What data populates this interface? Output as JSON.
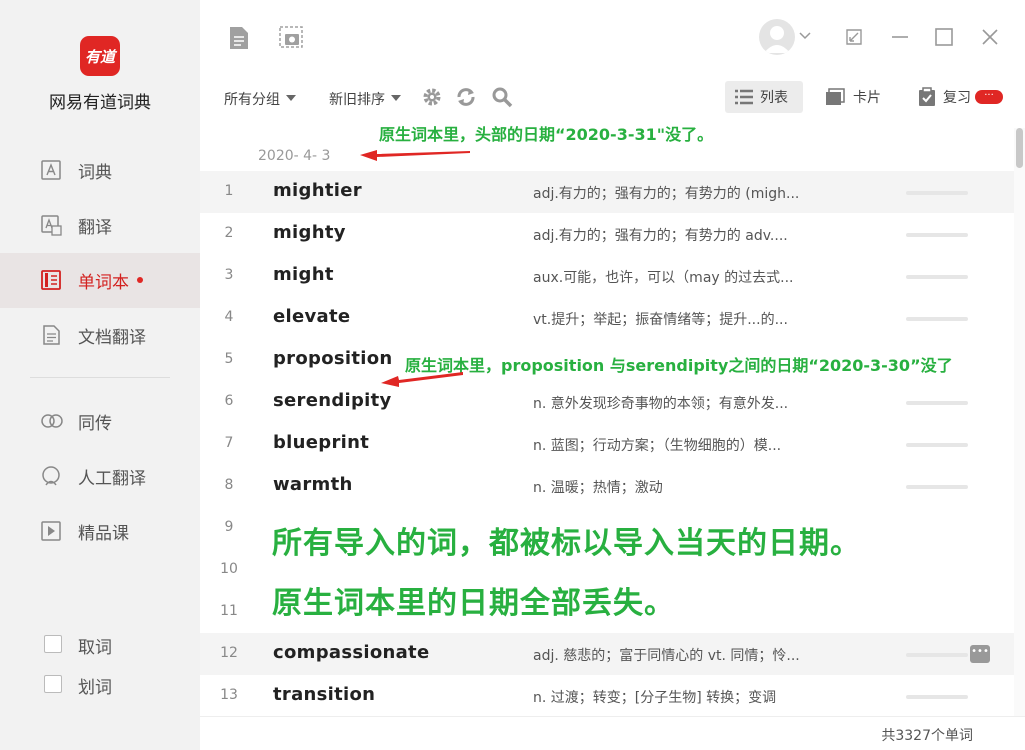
{
  "app": {
    "logo_text": "有道",
    "name": "网易有道词典"
  },
  "sidebar": {
    "items": [
      {
        "label": "词典",
        "icon": "dictionary-icon"
      },
      {
        "label": "翻译",
        "icon": "translate-icon"
      },
      {
        "label": "单词本",
        "icon": "wordbook-icon",
        "active": true
      },
      {
        "label": "文档翻译",
        "icon": "document-translate-icon"
      },
      {
        "label": "同传",
        "icon": "simultaneous-interpretation-icon"
      },
      {
        "label": "人工翻译",
        "icon": "human-translation-icon"
      },
      {
        "label": "精品课",
        "icon": "course-icon"
      }
    ],
    "checkboxes": [
      {
        "label": "取词"
      },
      {
        "label": "划词"
      }
    ]
  },
  "toolbar": {
    "group_filter": "所有分组",
    "sort_order": "新旧排序",
    "views": [
      {
        "label": "列表",
        "active": true
      },
      {
        "label": "卡片"
      },
      {
        "label": "复习",
        "badge": "···"
      }
    ]
  },
  "list": {
    "date_header": "2020- 4- 3",
    "rows": [
      {
        "num": "1",
        "word": "mightier",
        "def": "adj.有力的；强有力的；有势力的 (migh..."
      },
      {
        "num": "2",
        "word": "mighty",
        "def": "adj.有力的；强有力的；有势力的 adv...."
      },
      {
        "num": "3",
        "word": "might",
        "def": "aux.可能，也许，可以（may 的过去式..."
      },
      {
        "num": "4",
        "word": "elevate",
        "def": "vt.提升；举起；振奋情绪等；提升...的..."
      },
      {
        "num": "5",
        "word": "proposition",
        "def": ""
      },
      {
        "num": "6",
        "word": "serendipity",
        "def": "n. 意外发现珍奇事物的本领；有意外发..."
      },
      {
        "num": "7",
        "word": "blueprint",
        "def": "n. 蓝图；行动方案；（生物细胞的）模..."
      },
      {
        "num": "8",
        "word": "warmth",
        "def": "n. 温暖；热情；激动"
      },
      {
        "num": "9",
        "word": "",
        "def": ""
      },
      {
        "num": "10",
        "word": "",
        "def": ""
      },
      {
        "num": "11",
        "word": "",
        "def": ""
      },
      {
        "num": "12",
        "word": "compassionate",
        "def": "adj. 慈悲的；富于同情心的 vt. 同情；怜..."
      },
      {
        "num": "13",
        "word": "transition",
        "def": "n. 过渡；转变；[分子生物] 转换；变调"
      }
    ]
  },
  "footer": {
    "count": "共3327个单词"
  },
  "annotations": {
    "a1": "原生词本里，头部的日期“2020-3-31\"没了。",
    "a2": "原生词本里，proposition 与serendipity之间的日期“2020-3-30”没了",
    "a3": "所有导入的词，都被标以导入当天的日期。",
    "a4": "原生词本里的日期全部丢失。",
    "color": "#28b040",
    "arrow_color": "#e02724"
  },
  "colors": {
    "accent": "#e02724",
    "sidebar_bg": "#f2f2f2"
  }
}
